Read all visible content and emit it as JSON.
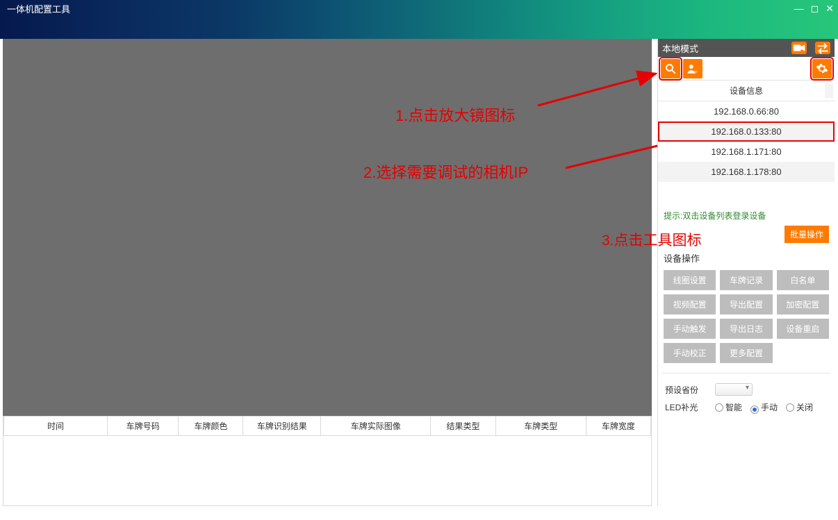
{
  "window": {
    "title": "一体机配置工具"
  },
  "annotations": {
    "step1": "1.点击放大镜图标",
    "step2": "2.选择需要调试的相机IP",
    "step3": "3.点击工具图标"
  },
  "right": {
    "mode_label": "本地模式",
    "device_info_header": "设备信息",
    "devices": [
      {
        "ip": "192.168.0.66:80"
      },
      {
        "ip": "192.168.0.133:80"
      },
      {
        "ip": "192.168.1.171:80"
      },
      {
        "ip": "192.168.1.178:80"
      }
    ],
    "hint": "提示:双击设备列表登录设备",
    "batch_label": "批量操作",
    "ops_title": "设备操作",
    "ops": {
      "coil": "线圈设置",
      "plate_record": "车牌记录",
      "whitelist": "白名单",
      "video_cfg": "视频配置",
      "export_cfg": "导出配置",
      "encrypt_cfg": "加密配置",
      "manual_trigger": "手动触发",
      "export_log": "导出日志",
      "reboot": "设备重启",
      "manual_correct": "手动校正",
      "more_cfg": "更多配置"
    },
    "preset_label": "预设省份",
    "led_label": "LED补光",
    "led_options": {
      "smart": "智能",
      "manual": "手动",
      "off": "关闭"
    },
    "led_selected": "manual"
  },
  "table": {
    "headers": {
      "time": "时间",
      "plate_no": "车牌号码",
      "plate_color": "车牌颜色",
      "recog_result": "车牌识别结果",
      "real_image": "车牌实际图像",
      "result_type": "结果类型",
      "plate_type": "车牌类型",
      "plate_width": "车牌宽度"
    }
  },
  "icons": {
    "search": "search-icon",
    "user_ip": "user-ip-icon",
    "gear": "gear-icon",
    "camera": "camera-icon",
    "swap": "swap-icon"
  }
}
